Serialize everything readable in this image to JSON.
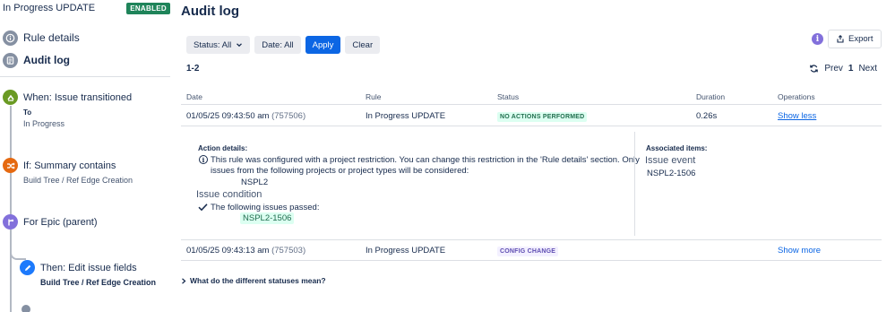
{
  "sidebar": {
    "rule_name": "In Progress UPDATE",
    "status_badge": "ENABLED",
    "nav": [
      {
        "label": "Rule details",
        "icon": "info-icon"
      },
      {
        "label": "Audit log",
        "icon": "list-icon"
      }
    ],
    "components": [
      {
        "title": "When: Issue transitioned",
        "lines": [
          "To",
          "In Progress"
        ],
        "icon": "transition-icon",
        "color": "#6a9a23"
      },
      {
        "title": "If: Summary contains",
        "lines": [
          "Build Tree / Ref Edge Creation"
        ],
        "icon": "shuffle-icon",
        "color": "#e56910"
      },
      {
        "title": "For Epic (parent)",
        "lines": [],
        "icon": "branch-icon",
        "color": "#8270db"
      },
      {
        "title": "Then: Edit issue fields",
        "lines": [
          "Build Tree / Ref Edge Creation"
        ],
        "icon": "pencil-icon",
        "color": "#1d7afc"
      }
    ]
  },
  "main": {
    "title": "Audit log",
    "filters": {
      "status": "Status: All",
      "date": "Date: All",
      "apply": "Apply",
      "clear": "Clear"
    },
    "info_glyph": "i",
    "export": "Export",
    "range": "1-2",
    "pager": {
      "prev": "Prev",
      "current": "1",
      "next": "Next"
    },
    "columns": [
      "Date",
      "Rule",
      "Status",
      "Duration",
      "Operations"
    ],
    "rows": [
      {
        "date": "01/05/25 09:43:50 am",
        "id": "(757506)",
        "rule": "In Progress UPDATE",
        "status": "NO ACTIONS PERFORMED",
        "duration": "0.26s",
        "operation": "Show less"
      },
      {
        "date": "01/05/25 09:43:13 am",
        "id": "(757503)",
        "rule": "In Progress UPDATE",
        "status": "CONFIG CHANGE",
        "duration": "",
        "operation": "Show more"
      }
    ],
    "details": {
      "action_heading": "Action details:",
      "info_glyph": "i",
      "restriction_line1": "This rule was configured with a project restriction. You can change this restriction in the 'Rule details' section. Only",
      "restriction_line2": "issues from the following projects or project types will be considered:",
      "project": "NSPL2",
      "condition_title": "Issue condition",
      "passed_text": "The following issues passed:",
      "passed_issue": "NSPL2-1506",
      "associated_heading": "Associated items:",
      "event_title": "Issue event",
      "event_issue": "NSPL2-1506"
    },
    "help": "What do the different statuses mean?"
  },
  "colors": {
    "primary": "#0c66e4",
    "enabled": "#1f845a",
    "status_green_bg": "#dcfff1",
    "status_purple_bg": "#f3f0ff"
  }
}
